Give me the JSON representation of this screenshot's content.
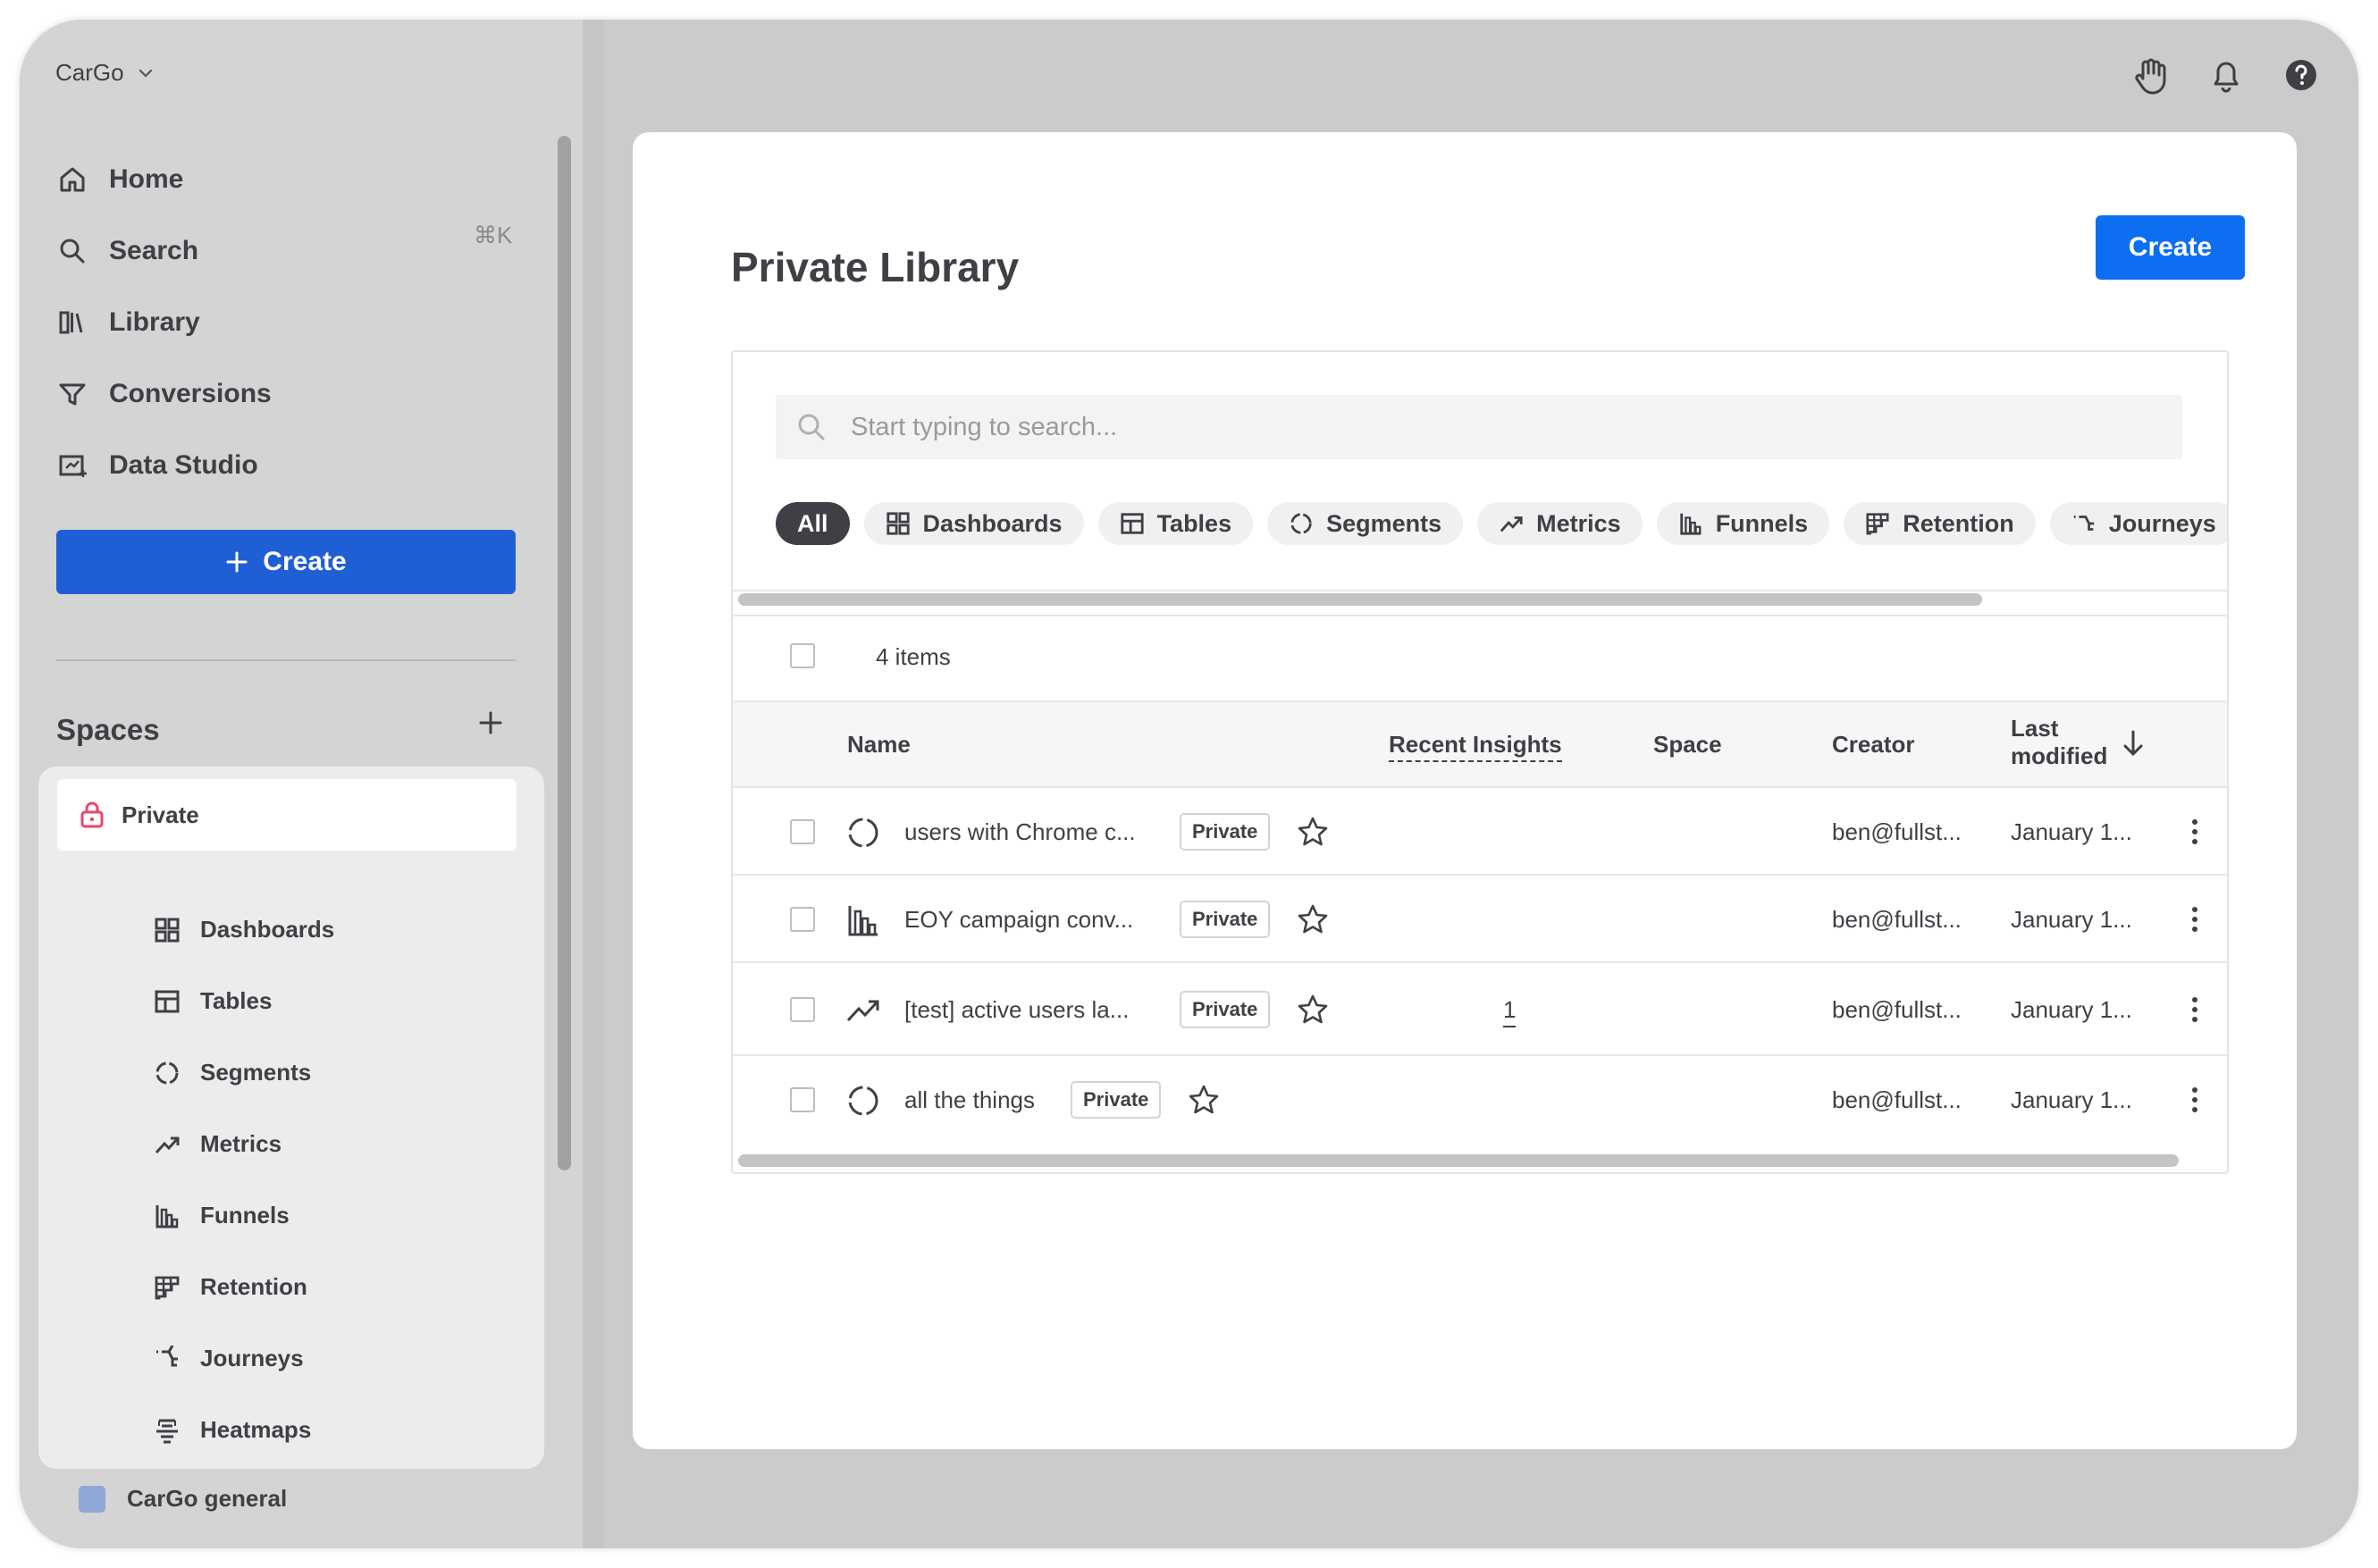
{
  "sidebar": {
    "workspace": "CarGo",
    "nav": [
      {
        "label": "Home",
        "icon": "home-icon"
      },
      {
        "label": "Search",
        "icon": "search-icon",
        "shortcut": "⌘K"
      },
      {
        "label": "Library",
        "icon": "library-icon"
      },
      {
        "label": "Conversions",
        "icon": "conversions-icon"
      },
      {
        "label": "Data Studio",
        "icon": "data-studio-icon"
      }
    ],
    "create_label": "Create",
    "spaces_title": "Spaces",
    "private_label": "Private",
    "private_items": [
      {
        "label": "Dashboards",
        "icon": "dashboards-icon"
      },
      {
        "label": "Tables",
        "icon": "tables-icon"
      },
      {
        "label": "Segments",
        "icon": "segments-icon"
      },
      {
        "label": "Metrics",
        "icon": "metrics-icon"
      },
      {
        "label": "Funnels",
        "icon": "funnels-icon"
      },
      {
        "label": "Retention",
        "icon": "retention-icon"
      },
      {
        "label": "Journeys",
        "icon": "journeys-icon"
      },
      {
        "label": "Heatmaps",
        "icon": "heatmaps-icon"
      }
    ],
    "other_space": "CarGo general"
  },
  "topbar": {
    "icons": [
      "hand-icon",
      "bell-icon",
      "help-icon"
    ]
  },
  "main": {
    "title": "Private Library",
    "create_label": "Create",
    "search_placeholder": "Start typing to search...",
    "filters": [
      "All",
      "Dashboards",
      "Tables",
      "Segments",
      "Metrics",
      "Funnels",
      "Retention",
      "Journeys"
    ],
    "items_count": "4 items",
    "columns": {
      "name": "Name",
      "recent_insights": "Recent Insights",
      "space": "Space",
      "creator": "Creator",
      "last_modified_line1": "Last",
      "last_modified_line2": "modified"
    },
    "rows": [
      {
        "name": "users with Chrome c...",
        "badge": "Private",
        "type_icon": "segments-icon",
        "insights": "",
        "creator": "ben@fullst...",
        "modified": "January 1..."
      },
      {
        "name": "EOY campaign conv...",
        "badge": "Private",
        "type_icon": "funnels-icon",
        "insights": "",
        "creator": "ben@fullst...",
        "modified": "January 1..."
      },
      {
        "name": "[test] active users la...",
        "badge": "Private",
        "type_icon": "metrics-icon",
        "insights": "1",
        "creator": "ben@fullst...",
        "modified": "January 1..."
      },
      {
        "name": "all the things",
        "badge": "Private",
        "type_icon": "segments-icon",
        "insights": "",
        "creator": "ben@fullst...",
        "modified": "January 1..."
      }
    ]
  },
  "colors": {
    "primary": "#0d6ef2",
    "sidebar_create": "#1f5fd6",
    "private_lock": "#e8476b"
  }
}
